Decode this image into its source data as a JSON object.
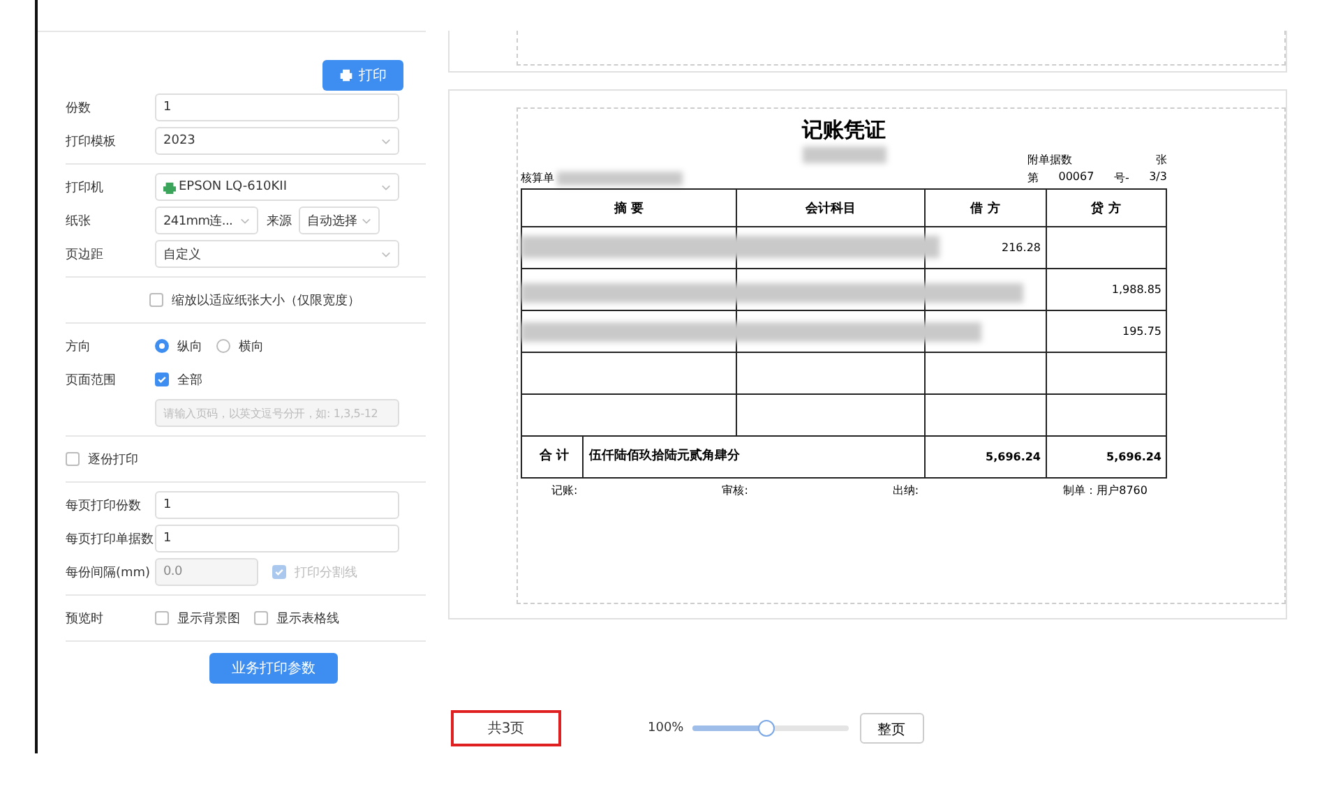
{
  "print_button": "打印",
  "copies": {
    "label": "份数",
    "value": "1"
  },
  "template": {
    "label": "打印模板",
    "value": "2023"
  },
  "printer": {
    "label": "打印机",
    "value": "EPSON LQ-610KII"
  },
  "paper": {
    "label": "纸张",
    "value": "241mm连...",
    "source_label": "来源",
    "source_value": "自动选择"
  },
  "margin": {
    "label": "页边距",
    "value": "自定义"
  },
  "fit_to_paper": {
    "label": "缩放以适应纸张大小（仅限宽度）",
    "checked": false
  },
  "orientation": {
    "label": "方向",
    "options": [
      {
        "label": "纵向",
        "selected": true
      },
      {
        "label": "横向",
        "selected": false
      }
    ]
  },
  "page_range": {
    "label": "页面范围",
    "all_label": "全部",
    "all_checked": true,
    "placeholder": "请输入页码，以英文逗号分开，如: 1,3,5-12"
  },
  "collate": {
    "label": "逐份打印",
    "checked": false
  },
  "per_page_copies": {
    "label": "每页打印份数",
    "value": "1"
  },
  "per_page_docs": {
    "label": "每页打印单据数",
    "value": "1"
  },
  "interval": {
    "label": "每份间隔(mm)",
    "value": "0.0",
    "divider_label": "打印分割线",
    "divider_checked": true
  },
  "preview_options": {
    "label": "预览时",
    "options": [
      {
        "label": "显示背景图",
        "checked": false
      },
      {
        "label": "显示表格线",
        "checked": false
      }
    ]
  },
  "business_params_button": "业务打印参数",
  "voucher": {
    "title": "记账凭证",
    "unit_label": "核算单",
    "attachments_label": "附单据数",
    "attachments_unit": "张",
    "number_prefix": "第",
    "number": "00067",
    "number_suffix": "号-",
    "page": "3/3",
    "columns": [
      "摘 要",
      "会计科目",
      "借 方",
      "贷 方"
    ],
    "rows": [
      {
        "debit": "216.28",
        "credit": ""
      },
      {
        "debit": "",
        "credit": "1,988.85"
      },
      {
        "debit": "",
        "credit": "195.75"
      },
      {
        "debit": "",
        "credit": ""
      },
      {
        "debit": "",
        "credit": ""
      }
    ],
    "total": {
      "label": "合 计",
      "amount_words": "伍仟陆佰玖拾陆元贰角肆分",
      "debit": "5,696.24",
      "credit": "5,696.24"
    },
    "footer": [
      "记账:",
      "审核:",
      "出纳:",
      "制单：用户8760"
    ]
  },
  "pager": {
    "total_pages": "共3页",
    "zoom": "100%",
    "level": 0.48,
    "fit_button": "整页"
  }
}
